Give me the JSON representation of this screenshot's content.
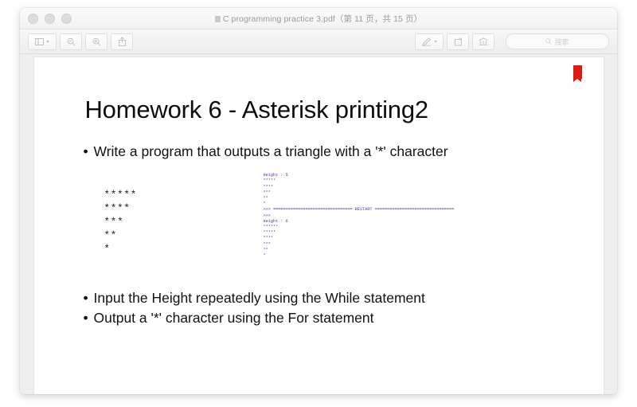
{
  "window": {
    "title": "C programming practice 3.pdf（第 11 页，共 15 页）",
    "traffic_lights": [
      "close",
      "minimize",
      "zoom"
    ]
  },
  "toolbar": {
    "sidebar_button_label": "",
    "zoom_out_label": "",
    "zoom_in_label": "",
    "share_label": "",
    "markup_label": "",
    "rotate_label": "",
    "export_label": "",
    "search_placeholder": "搜索"
  },
  "document": {
    "bookmark": "bookmark",
    "slide": {
      "title": "Homework 6 - Asterisk printing2",
      "bullets": [
        "Write a program that outputs a triangle with a '*' character",
        "Input the Height repeatedly using the While statement",
        "Output a '*' character using the For statement"
      ],
      "bullet_marker": "•",
      "asterisk_figure": "*****\n****\n***\n**\n*",
      "console_output": "Height : 5\n*****\n****\n***\n**\n*\n>>> ================================ RESTART ================================\n>>> \nHeight : 6\n******\n*****\n****\n***\n**\n*"
    }
  },
  "colors": {
    "bookmark_red": "#e01b10",
    "console_blue": "#3b3bb0",
    "console_prompt": "#7a0f7a",
    "page_background": "#ffffff",
    "window_chrome": "#f2f2f2"
  }
}
